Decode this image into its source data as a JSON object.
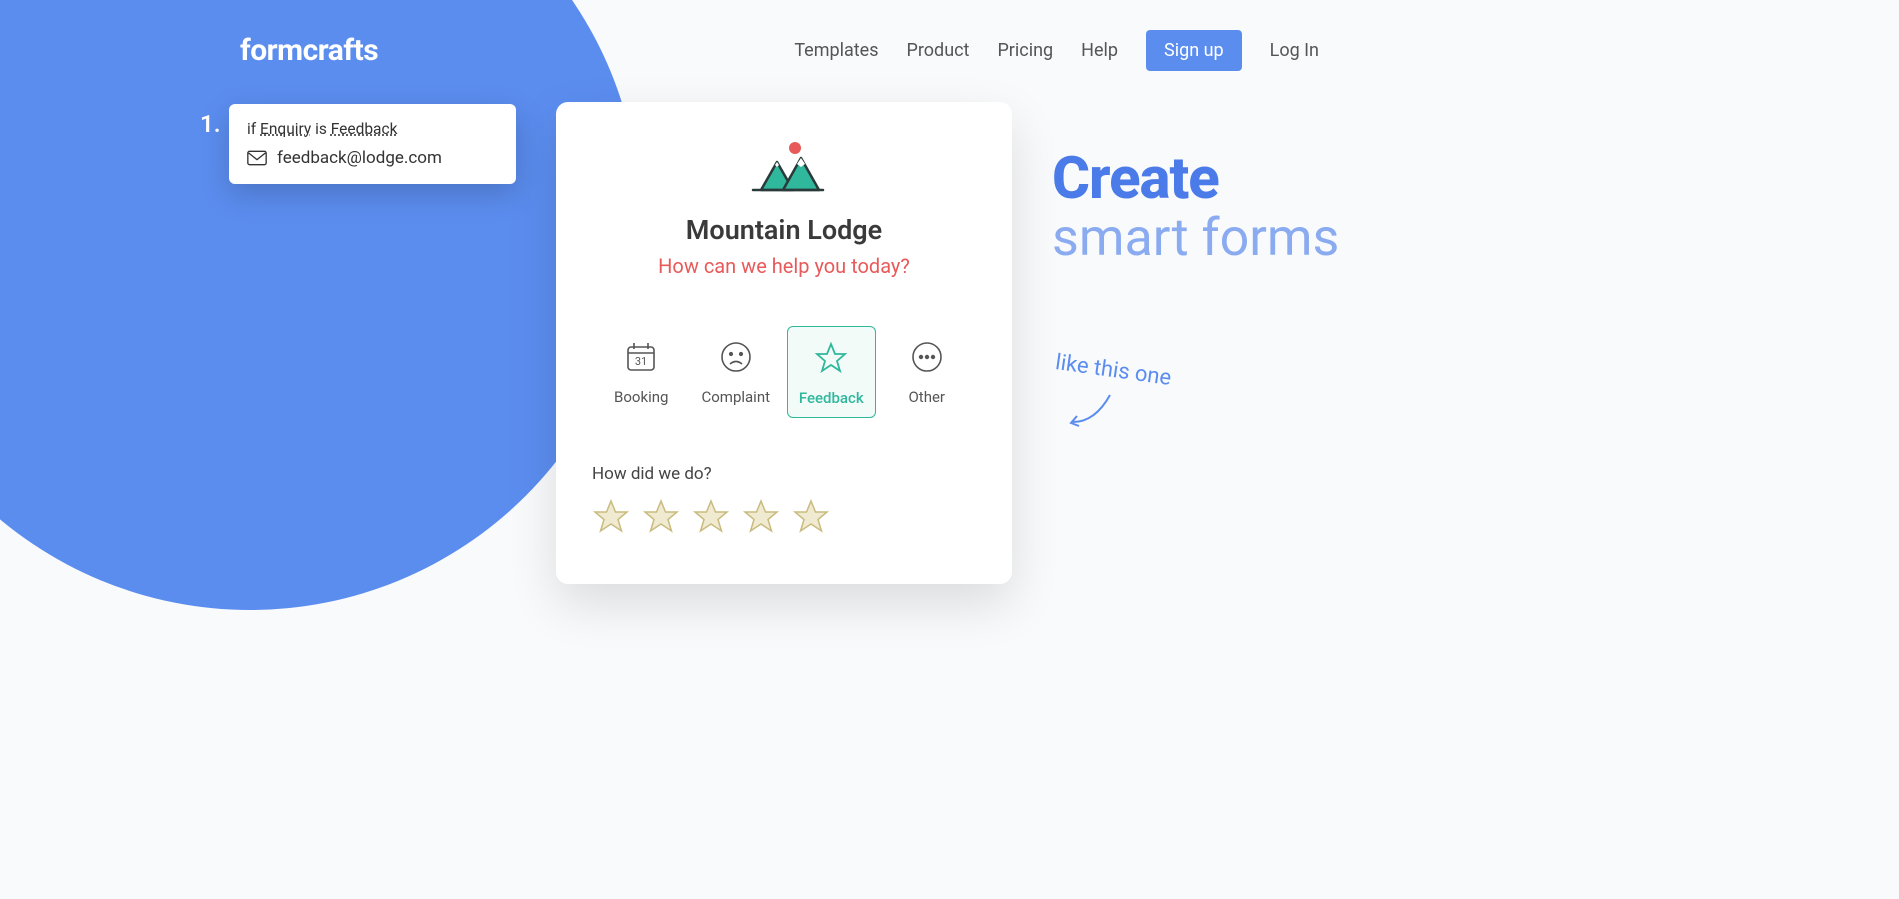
{
  "logo": "formcrafts",
  "nav": {
    "templates": "Templates",
    "product": "Product",
    "pricing": "Pricing",
    "help": "Help",
    "signup": "Sign up",
    "login": "Log In"
  },
  "rule": {
    "number": "1.",
    "if": "if",
    "enquiry": "Enquiry",
    "is": "is",
    "feedback": "Feedback",
    "email": "feedback@lodge.com"
  },
  "form": {
    "title": "Mountain Lodge",
    "subtitle": "How can we help you today?",
    "options": {
      "booking": "Booking",
      "complaint": "Complaint",
      "feedback": "Feedback",
      "other": "Other"
    },
    "calendar_day": "31",
    "question": "How did we do?"
  },
  "hero": {
    "line1": "Create",
    "line2": "smart forms",
    "annotation": "like this one"
  }
}
